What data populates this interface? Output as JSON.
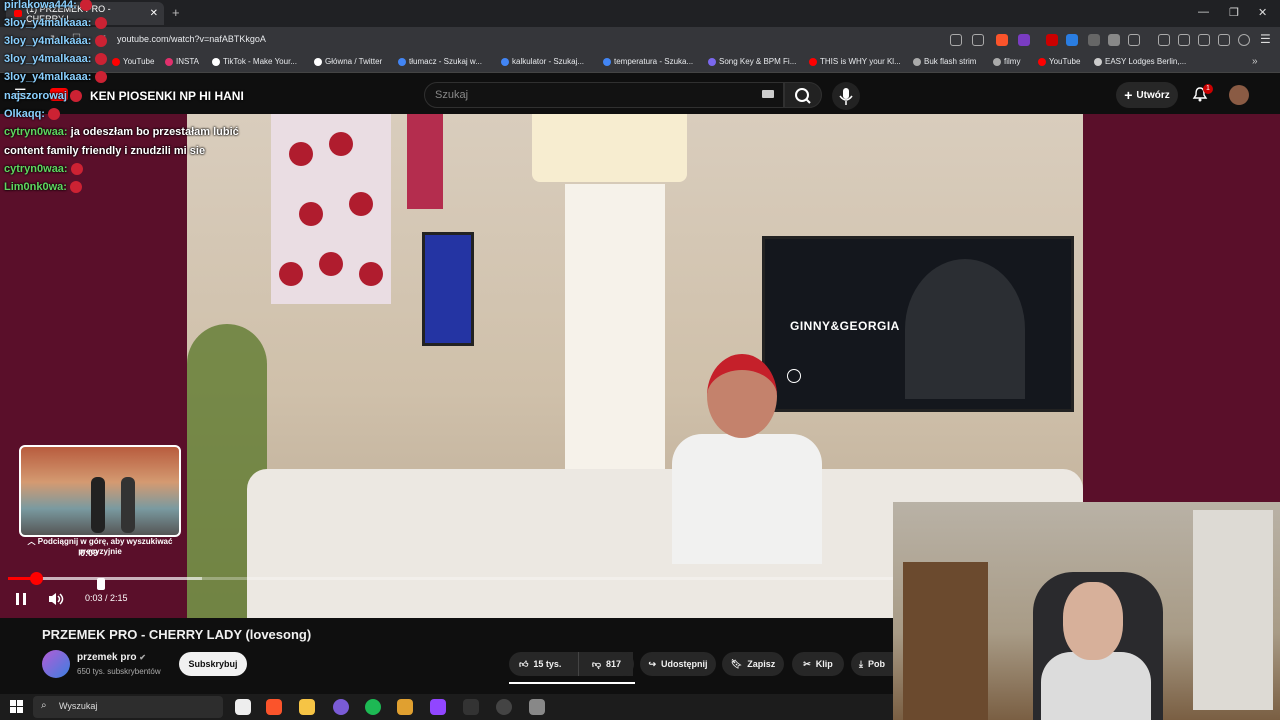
{
  "browser": {
    "tab_title": "(1) PRZEMEK PRO - CHERRY L",
    "url": "youtube.com/watch?v=nafABTKkgoA",
    "bookmarks": [
      {
        "label": "YouTube",
        "color": "#ff0000"
      },
      {
        "label": "INSTA",
        "color": "#e1306c"
      },
      {
        "label": "TikTok - Make Your...",
        "color": "#ffffff"
      },
      {
        "label": "Główna / Twitter",
        "color": "#ffffff"
      },
      {
        "label": "tłumacz - Szukaj w...",
        "color": "#4285f4"
      },
      {
        "label": "kalkulator - Szukaj...",
        "color": "#4285f4"
      },
      {
        "label": "temperatura - Szuka...",
        "color": "#4285f4"
      },
      {
        "label": "Song Key & BPM Fi...",
        "color": "#7b68ee"
      },
      {
        "label": "THIS is WHY your Kl...",
        "color": "#ff0000"
      },
      {
        "label": "Buk flash strim",
        "color": "#aaaaaa"
      },
      {
        "label": "filmy",
        "color": "#aaaaaa"
      },
      {
        "label": "YouTube",
        "color": "#ff0000"
      },
      {
        "label": "EASY Lodges Berlin,...",
        "color": "#cccccc"
      }
    ]
  },
  "youtube": {
    "search_placeholder": "Szukaj",
    "create_label": "Utwórz",
    "notification_count": "1",
    "header_overlay_text": "KEN PIOSENKI NP HI HANI"
  },
  "chat": [
    {
      "user": "pirlakowa444:",
      "text": ""
    },
    {
      "user": "3loy_y4malkaaa:",
      "text": ""
    },
    {
      "user": "3loy_y4malkaaa:",
      "text": ""
    },
    {
      "user": "3loy_y4malkaaa:",
      "text": ""
    },
    {
      "user": "3loy_y4malkaaa:",
      "text": ""
    },
    {
      "user": "najszorowaj",
      "text": ""
    },
    {
      "user": "Olkaqq:",
      "text": ""
    },
    {
      "user": "cytryn0waa:",
      "text": "ja odeszłam bo przestałam lubić"
    },
    {
      "user": "",
      "text": "content family friendly i znudzili mi sie"
    },
    {
      "user": "cytryn0waa:",
      "text": ""
    },
    {
      "user": "Lim0nk0wa:",
      "text": ""
    }
  ],
  "tv": {
    "title": "GINNY&GEORGIA"
  },
  "player": {
    "seek_hint": "Podciągnij w górę, aby wyszukiwać precyzyjnie",
    "preview_time": "0:09",
    "time_display": "0:03 / 2:15",
    "progress_fraction": 0.022
  },
  "video": {
    "title": "PRZEMEK PRO - CHERRY LADY (lovesong)",
    "channel_name": "przemek pro",
    "subscribers": "650 tys. subskrybentów",
    "subscribe_label": "Subskrybuj",
    "likes": "15 tys.",
    "dislikes": "817",
    "share_label": "Udostępnij",
    "save_label": "Zapisz",
    "clip_label": "Klip",
    "download_label": "Pob"
  },
  "taskbar": {
    "search_placeholder": "Wyszukaj"
  }
}
